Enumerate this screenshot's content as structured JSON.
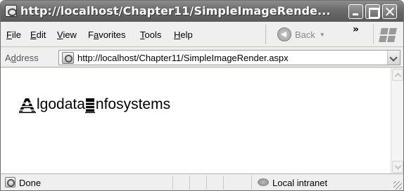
{
  "window": {
    "title": "http://localhost/Chapter11/SimpleImageRende..."
  },
  "menu": {
    "items": [
      {
        "underlined": "F",
        "rest": "ile"
      },
      {
        "underlined": "E",
        "rest": "dit"
      },
      {
        "underlined": "V",
        "rest": "iew"
      },
      {
        "prefix": "F",
        "underlined": "a",
        "rest": "vorites"
      },
      {
        "underlined": "T",
        "rest": "ools"
      },
      {
        "underlined": "H",
        "rest": "elp"
      }
    ],
    "back_label": "Back",
    "more": "»"
  },
  "address": {
    "label_prefix": "A",
    "label_underlined": "d",
    "label_rest": "dress",
    "url": "http://localhost/Chapter11/SimpleImageRender.aspx"
  },
  "content": {
    "render_cap1": "A",
    "render_word1": "lgodata",
    "render_cap2": "I",
    "render_word2": "nfosystems"
  },
  "status": {
    "text": "Done",
    "zone": "Local intranet"
  },
  "icons": {
    "page": "ie-page-icon",
    "zone": "intranet-zone-icon"
  }
}
